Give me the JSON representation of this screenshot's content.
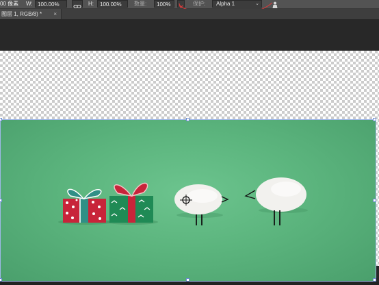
{
  "options_bar": {
    "ref_label": "00 像素",
    "w_label": "W:",
    "w_value": "100.00%",
    "h_label": "H:",
    "h_value": "100.00%",
    "count_label": "数量:",
    "count_value": "100%",
    "protect_label": "保护:",
    "protect_value": "Alpha 1"
  },
  "document_tab": {
    "title": "图层 1, RGB/8) *",
    "close": "×"
  },
  "colors": {
    "annotation_red": "#d83a3a",
    "photo_green": "#5cb57e",
    "selection_border": "#9fb8e8"
  },
  "photo": {
    "subjects": [
      "gift-box-red",
      "gift-box-green",
      "pebble-bird-left",
      "pebble-bird-right"
    ]
  }
}
